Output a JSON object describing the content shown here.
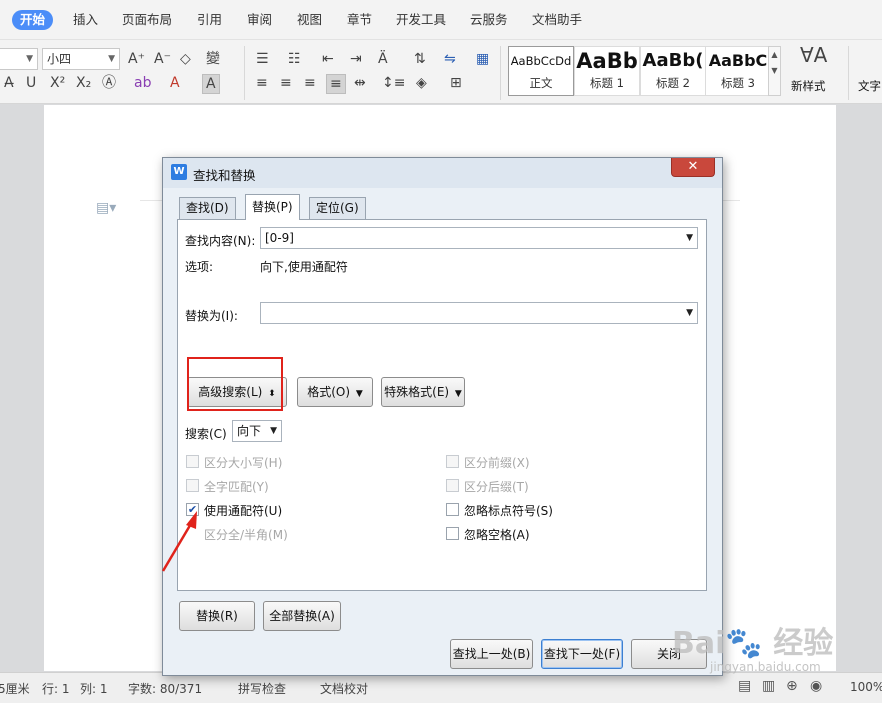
{
  "menubar": {
    "items": [
      "开始",
      "插入",
      "页面布局",
      "引用",
      "审阅",
      "视图",
      "章节",
      "开发工具",
      "云服务",
      "文档助手"
    ]
  },
  "ribbon": {
    "font_name": "",
    "font_size": "小四",
    "styles": [
      {
        "sample": "AaBbCcDd",
        "name": "正文"
      },
      {
        "sample": "AaBb",
        "name": "标题 1"
      },
      {
        "sample": "AaBb(",
        "name": "标题 2"
      },
      {
        "sample": "AaBbC",
        "name": "标题 3"
      }
    ],
    "new_style_label": "新样式",
    "text_tools_label": "文字"
  },
  "status": {
    "unit": "5厘米",
    "line": "行: 1",
    "col": "列: 1",
    "word_count": "字数: 80/371",
    "spell_check": "拼写检查",
    "doc_check": "文档校对",
    "zoom": "100%"
  },
  "dialog": {
    "title": "查找和替换",
    "close_glyph": "✕",
    "tabs": [
      "查找(D)",
      "替换(P)",
      "定位(G)"
    ],
    "find_label": "查找内容(N):",
    "find_value": "[0-9]",
    "options_label": "选项:",
    "options_value": "向下,使用通配符",
    "replace_label": "替换为(I):",
    "replace_value": "",
    "advanced_label": "高级搜索(L)",
    "format_label": "格式(O)",
    "special_label": "特殊格式(E)",
    "search_label": "搜索(C)",
    "search_value": "向下",
    "checkboxes_left": [
      {
        "label": "区分大小写(H)",
        "checked": false,
        "disabled": true
      },
      {
        "label": "全字匹配(Y)",
        "checked": false,
        "disabled": true
      },
      {
        "label": "使用通配符(U)",
        "checked": true,
        "disabled": false
      },
      {
        "label": "区分全/半角(M)",
        "checked": false,
        "disabled": true
      }
    ],
    "checkboxes_right": [
      {
        "label": "区分前缀(X)",
        "checked": false,
        "disabled": true
      },
      {
        "label": "区分后缀(T)",
        "checked": false,
        "disabled": true
      },
      {
        "label": "忽略标点符号(S)",
        "checked": false,
        "disabled": false
      },
      {
        "label": "忽略空格(A)",
        "checked": false,
        "disabled": false
      }
    ],
    "replace_btn": "替换(R)",
    "replace_all_btn": "全部替换(A)",
    "find_prev_btn": "查找上一处(B)",
    "find_next_btn": "查找下一处(F)",
    "close_btn": "关闭"
  },
  "colors": {
    "accent": "#4b8df8",
    "annotation": "#e0231b"
  }
}
